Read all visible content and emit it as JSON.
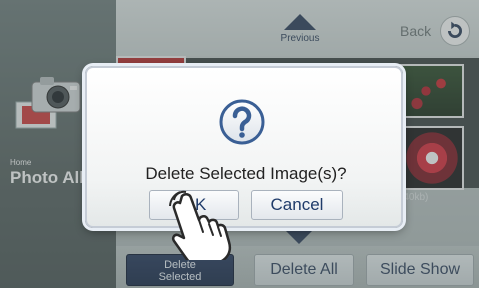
{
  "app": {
    "breadcrumb_home": "Home",
    "breadcrumb_title": "Photo Album"
  },
  "header": {
    "previous_label": "Previous",
    "back_label": "Back"
  },
  "thumbnails": {
    "size_label": "(40kb)"
  },
  "toolbar": {
    "delete_selected_line1": "Delete",
    "delete_selected_line2": "Selected",
    "delete_all_label": "Delete All",
    "slide_show_label": "Slide Show"
  },
  "dialog": {
    "message": "Delete Selected Image(s)?",
    "ok_label": "OK",
    "cancel_label": "Cancel",
    "icon": "question-icon"
  },
  "colors": {
    "accent_navy": "#2b3d58",
    "dialog_button_text": "#1f3b6a"
  }
}
